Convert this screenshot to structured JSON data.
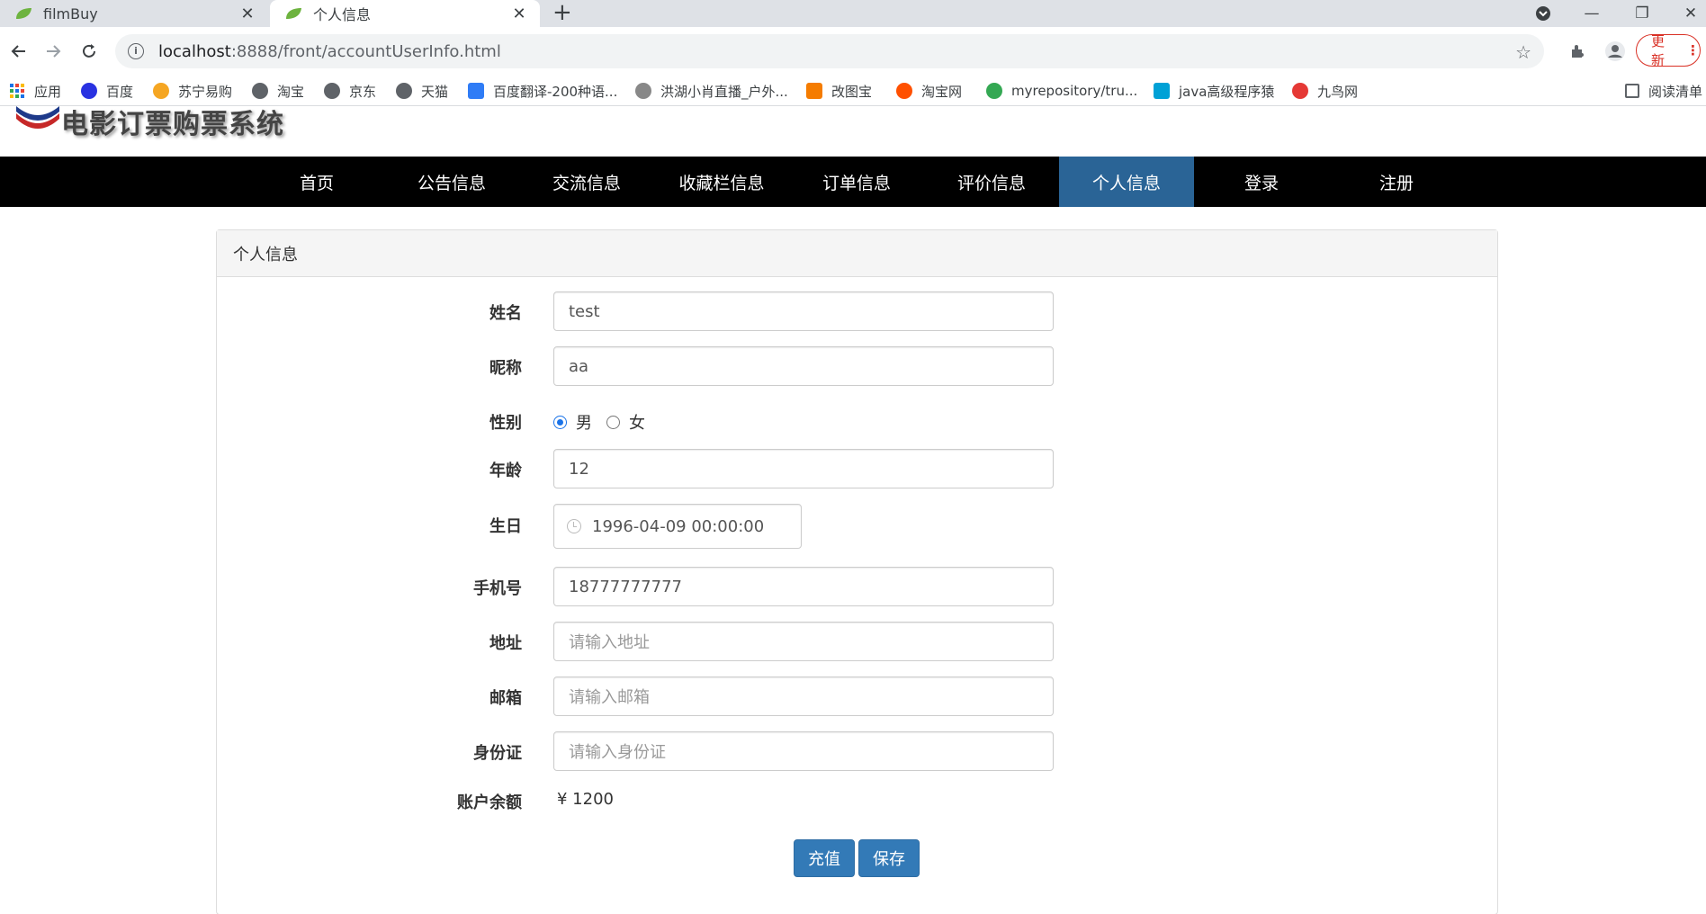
{
  "browser": {
    "tabs": [
      {
        "title": "filmBuy",
        "active": false
      },
      {
        "title": "个人信息",
        "active": true
      }
    ],
    "url_host": "localhost",
    "url_rest": ":8888/front/accountUserInfo.html",
    "update_label": "更新",
    "bookmarks": [
      {
        "label": "应用",
        "icon": "apps-grid-icon",
        "color": "#1a73e8"
      },
      {
        "label": "百度",
        "icon": "baidu-paw-icon",
        "color": "#2932e1"
      },
      {
        "label": "苏宁易购",
        "icon": "suning-lion-icon",
        "color": "#f5a623"
      },
      {
        "label": "淘宝",
        "icon": "globe-icon",
        "color": "#5f6368"
      },
      {
        "label": "京东",
        "icon": "globe-icon",
        "color": "#5f6368"
      },
      {
        "label": "天猫",
        "icon": "globe-icon",
        "color": "#5f6368"
      },
      {
        "label": "百度翻译-200种语...",
        "icon": "baidu-translate-icon",
        "color": "#2f7cf6"
      },
      {
        "label": "洪湖小肖直播_户外...",
        "icon": "live-bird-icon",
        "color": "#888888"
      },
      {
        "label": "改图宝",
        "icon": "gaitubao-icon",
        "color": "#f57c00"
      },
      {
        "label": "淘宝网",
        "icon": "taobao-icon",
        "color": "#ff5000"
      },
      {
        "label": "myrepository/tru...",
        "icon": "chrome-icon",
        "color": "#34a853"
      },
      {
        "label": "java高级程序猿",
        "icon": "bilibili-icon",
        "color": "#00a1d6"
      },
      {
        "label": "九鸟网",
        "icon": "bird-icon",
        "color": "#e53935"
      }
    ],
    "reading_list": "阅读清单"
  },
  "site": {
    "logo_text": "电影订票购票系统",
    "nav": [
      "首页",
      "公告信息",
      "交流信息",
      "收藏栏信息",
      "订单信息",
      "评价信息",
      "个人信息",
      "登录",
      "注册"
    ],
    "active_nav": "个人信息"
  },
  "form": {
    "panel_title": "个人信息",
    "name_label": "姓名",
    "name_value": "test",
    "nickname_label": "昵称",
    "nickname_value": "aa",
    "gender_label": "性别",
    "gender_male": "男",
    "gender_female": "女",
    "gender_selected": "男",
    "age_label": "年龄",
    "age_value": "12",
    "birthday_label": "生日",
    "birthday_value": "1996-04-09 00:00:00",
    "phone_label": "手机号",
    "phone_value": "18777777777",
    "address_label": "地址",
    "address_placeholder": "请输入地址",
    "email_label": "邮箱",
    "email_placeholder": "请输入邮箱",
    "idcard_label": "身份证",
    "idcard_placeholder": "请输入身份证",
    "balance_label": "账户余额",
    "balance_value": "¥ 1200",
    "recharge_label": "充值",
    "save_label": "保存"
  },
  "colors": {
    "nav_bg": "#000000",
    "nav_active": "#2a6496",
    "button": "#337ab7"
  }
}
